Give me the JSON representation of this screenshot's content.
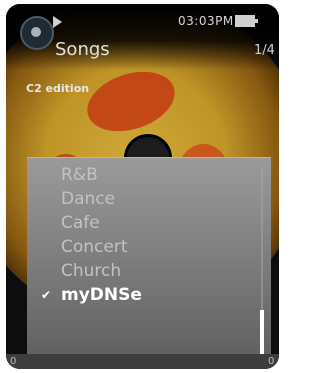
{
  "status": {
    "time": "03:03PM"
  },
  "header": {
    "folder_title": "Songs",
    "track_counter": "1/4",
    "subtitle": "C2 edition"
  },
  "menu": {
    "items": [
      {
        "label": "R&B",
        "selected": false
      },
      {
        "label": "Dance",
        "selected": false
      },
      {
        "label": "Cafe",
        "selected": false
      },
      {
        "label": "Concert",
        "selected": false
      },
      {
        "label": "Church",
        "selected": false
      },
      {
        "label": "myDNSe",
        "selected": true
      }
    ],
    "check_glyph": "✔"
  },
  "footer": {
    "left": "0",
    "right": "0"
  },
  "icons": [
    "player-logo-icon",
    "play-icon",
    "battery-icon",
    "check-icon"
  ]
}
